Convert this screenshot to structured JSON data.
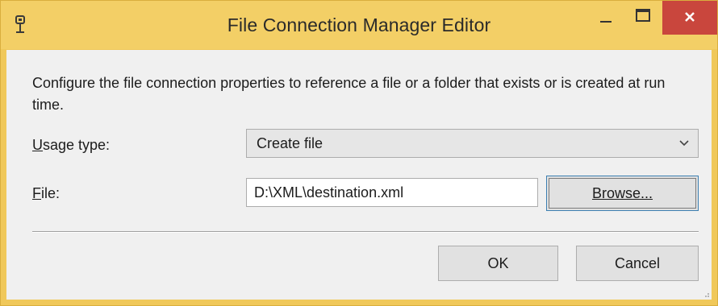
{
  "window": {
    "title": "File Connection Manager Editor"
  },
  "dialog": {
    "description": "Configure the file connection properties to reference a file or a folder that exists or is created at run time.",
    "usage_type": {
      "label_mnemonic": "U",
      "label_rest": "sage type:",
      "selected_value": "Create file"
    },
    "file": {
      "label_mnemonic": "F",
      "label_rest": "ile:",
      "value": "D:\\XML\\destination.xml"
    },
    "buttons": {
      "browse": "Browse...",
      "ok": "OK",
      "cancel": "Cancel"
    }
  },
  "icons": {
    "app": "connection-icon",
    "minimize": "minimize-icon",
    "maximize": "maximize-icon",
    "close": "close-icon",
    "dropdown": "chevron-down-icon"
  },
  "colors": {
    "titlebar": "#f3cf66",
    "close_button": "#c9463d",
    "client_bg": "#f0f0f0",
    "focus_border": "#3c7fb1"
  }
}
